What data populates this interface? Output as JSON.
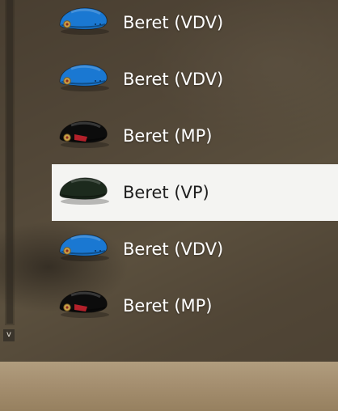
{
  "inventory": {
    "items": [
      {
        "label": "Beret (VDV)",
        "icon": "beret-vdv-icon",
        "color": "#1a78d2",
        "badge": "emblem",
        "selected": false
      },
      {
        "label": "Beret (VDV)",
        "icon": "beret-vdv-icon",
        "color": "#1a78d2",
        "badge": "emblem",
        "selected": false
      },
      {
        "label": "Beret (MP)",
        "icon": "beret-mp-icon",
        "color": "#0c0c0c",
        "badge": "emblem-flag",
        "selected": false
      },
      {
        "label": "Beret (VP)",
        "icon": "beret-vp-icon",
        "color": "#1c2a1d",
        "badge": "none",
        "selected": true
      },
      {
        "label": "Beret (VDV)",
        "icon": "beret-vdv-icon",
        "color": "#1a78d2",
        "badge": "emblem",
        "selected": false
      },
      {
        "label": "Beret (MP)",
        "icon": "beret-mp-icon",
        "color": "#0c0c0c",
        "badge": "emblem-flag",
        "selected": false
      }
    ]
  },
  "scrollbar": {
    "down_button_label": "v"
  },
  "colors": {
    "selected_row": "#f4f4f2",
    "accent_flag": "#b3202a",
    "emblem": "#c9a24a"
  }
}
